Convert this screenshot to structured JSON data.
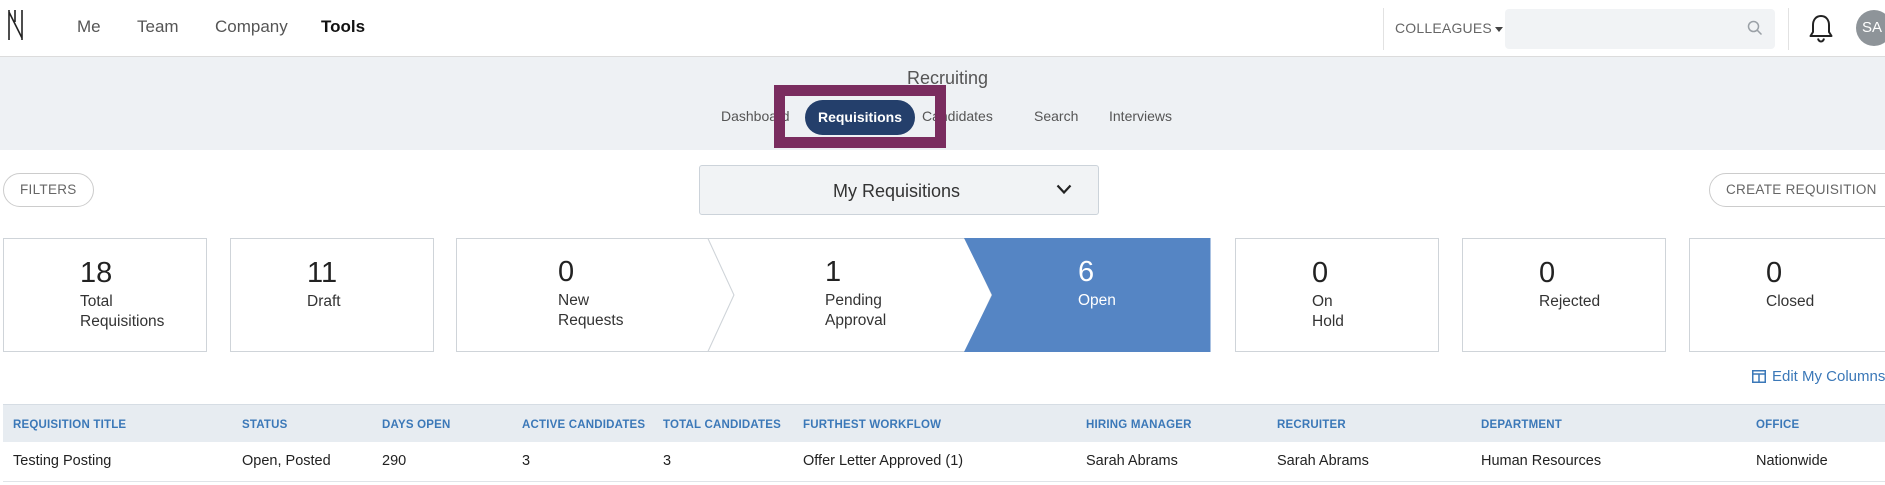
{
  "topnav": {
    "items": [
      "Me",
      "Team",
      "Company",
      "Tools"
    ],
    "active": "Tools",
    "colleagues_label": "COLLEAGUES",
    "search_value": "",
    "avatar_initials": "SA"
  },
  "subheader": {
    "title": "Recruiting",
    "tabs": [
      {
        "label": "Dashboard"
      },
      {
        "label": "Requisitions",
        "active": true
      },
      {
        "label": "Candidates"
      },
      {
        "label": "Search"
      },
      {
        "label": "Interviews"
      }
    ]
  },
  "toolbar": {
    "filters_label": "FILTERS",
    "view_selected": "My Requisitions",
    "create_label": "CREATE REQUISITION"
  },
  "stats": [
    {
      "value": "18",
      "label": [
        "Total",
        "Requisitions"
      ]
    },
    {
      "value": "11",
      "label": [
        "Draft"
      ]
    },
    {
      "value": "0",
      "label": [
        "New",
        "Requests"
      ]
    },
    {
      "value": "1",
      "label": [
        "Pending",
        "Approval"
      ]
    },
    {
      "value": "6",
      "label": [
        "Open"
      ]
    },
    {
      "value": "0",
      "label": [
        "On",
        "Hold"
      ]
    },
    {
      "value": "0",
      "label": [
        "Rejected"
      ]
    },
    {
      "value": "0",
      "label": [
        "Closed"
      ]
    }
  ],
  "colors": {
    "active_tab": "#243f6b",
    "highlight_frame": "#7a2d5f",
    "open_stage": "#5585c4",
    "link_blue": "#3b78b8"
  },
  "edit_columns_label": "Edit My Columns",
  "table": {
    "columns": [
      "REQUISITION TITLE",
      "STATUS",
      "DAYS OPEN",
      "ACTIVE CANDIDATES",
      "TOTAL CANDIDATES",
      "FURTHEST WORKFLOW",
      "HIRING MANAGER",
      "RECRUITER",
      "DEPARTMENT",
      "OFFICE"
    ],
    "rows": [
      [
        "Testing Posting",
        "Open, Posted",
        "290",
        "3",
        "3",
        "Offer Letter Approved (1)",
        "Sarah Abrams",
        "Sarah Abrams",
        "Human Resources",
        "Nationwide"
      ]
    ]
  }
}
